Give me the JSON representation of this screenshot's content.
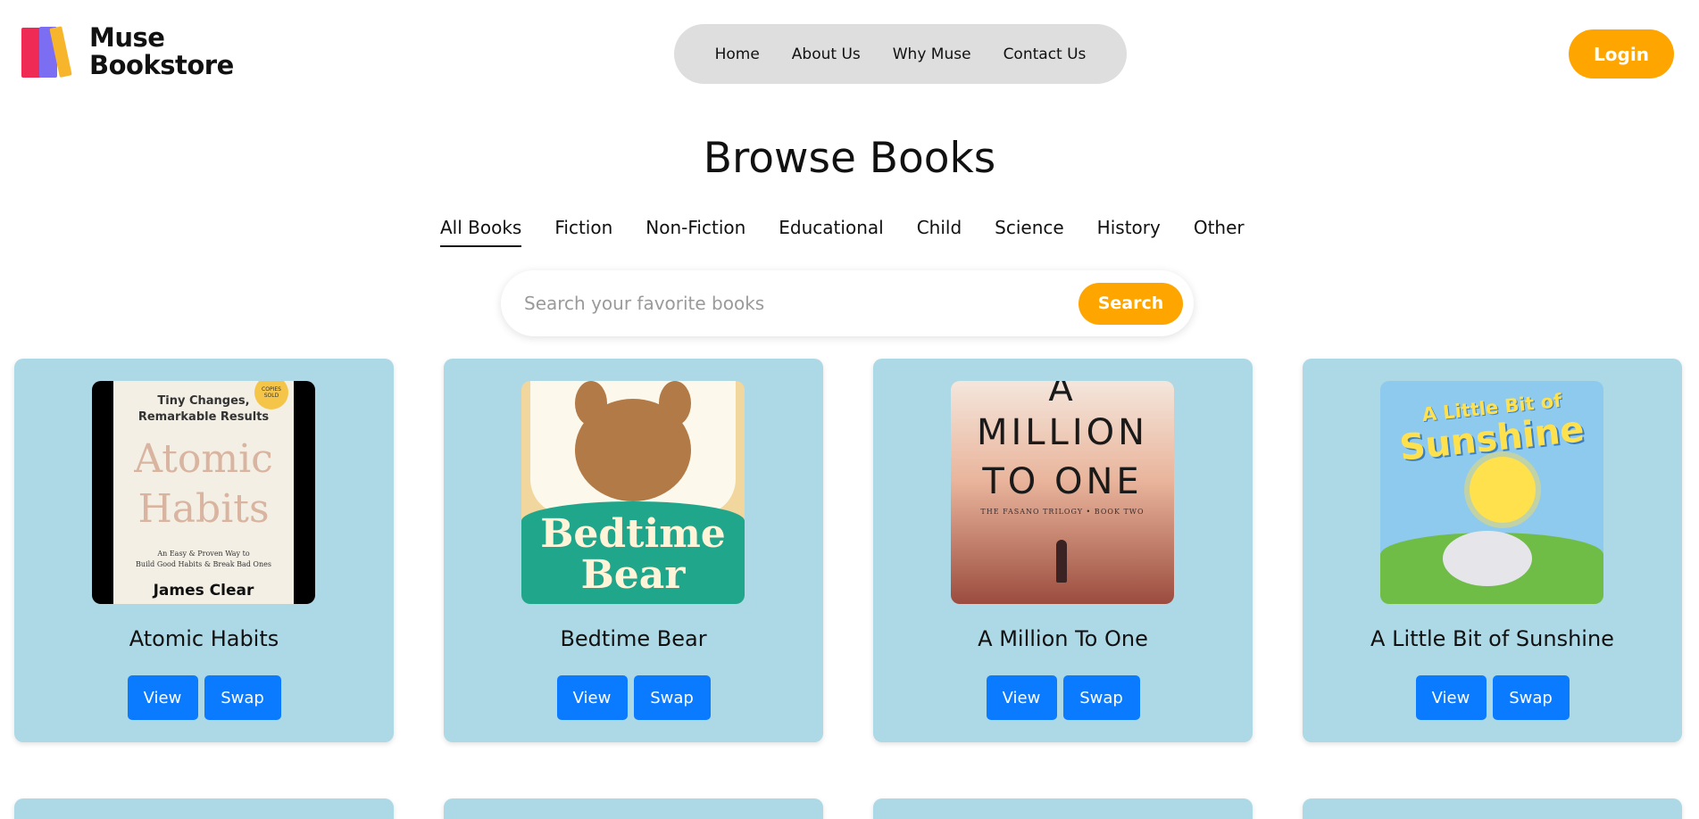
{
  "brand": {
    "name_line1": "Muse",
    "name_line2": "Bookstore"
  },
  "nav": {
    "items": [
      {
        "label": "Home"
      },
      {
        "label": "About Us"
      },
      {
        "label": "Why Muse"
      },
      {
        "label": "Contact Us"
      }
    ]
  },
  "header": {
    "login_label": "Login"
  },
  "page": {
    "title": "Browse Books"
  },
  "categories": {
    "active": "All Books",
    "items": [
      {
        "label": "All Books"
      },
      {
        "label": "Fiction"
      },
      {
        "label": "Non-Fiction"
      },
      {
        "label": "Educational"
      },
      {
        "label": "Child"
      },
      {
        "label": "Science"
      },
      {
        "label": "History"
      },
      {
        "label": "Other"
      }
    ]
  },
  "search": {
    "placeholder": "Search your favorite books",
    "value": "",
    "button_label": "Search"
  },
  "books": [
    {
      "title": "Atomic Habits",
      "view_label": "View",
      "swap_label": "Swap",
      "cover": {
        "tagline_1": "Tiny Changes,",
        "tagline_2": "Remarkable Results",
        "title_1": "Atomic",
        "title_2": "Habits",
        "subtitle_1": "An Easy & Proven Way to",
        "subtitle_2": "Build Good Habits & Break Bad Ones",
        "author": "James Clear",
        "sticker": "COPIES SOLD"
      }
    },
    {
      "title": "Bedtime Bear",
      "view_label": "View",
      "swap_label": "Swap",
      "cover": {
        "title_1": "Bedtime",
        "title_2": "Bear"
      }
    },
    {
      "title": "A Million To One",
      "view_label": "View",
      "swap_label": "Swap",
      "cover": {
        "line_1": "A",
        "line_2": "MILLION",
        "line_3": "TO ONE",
        "fine": "THE FASANO TRILOGY • BOOK TWO"
      }
    },
    {
      "title": "A Little Bit of Sunshine",
      "view_label": "View",
      "swap_label": "Swap",
      "cover": {
        "title_1": "A Little Bit of",
        "title_2": "Sunshine"
      }
    }
  ],
  "colors": {
    "accent": "#ffa500",
    "card_bg": "#add8e6",
    "button_blue": "#0a7bff",
    "nav_bg": "#dedede"
  }
}
